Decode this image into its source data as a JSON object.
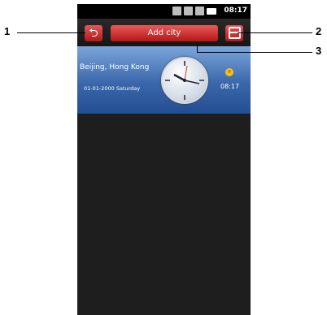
{
  "status_bar": {
    "time": "08:17"
  },
  "toolbar": {
    "add_city_label": "Add city"
  },
  "city_card": {
    "city": "Beijing, Hong Kong",
    "date": "01-01-2000  Saturday",
    "time": "08:17"
  },
  "callouts": {
    "one": "1",
    "two": "2",
    "three": "3"
  },
  "icons": {
    "back": "back-arrow-icon",
    "menu": "list-menu-icon",
    "day": "sun-icon"
  }
}
